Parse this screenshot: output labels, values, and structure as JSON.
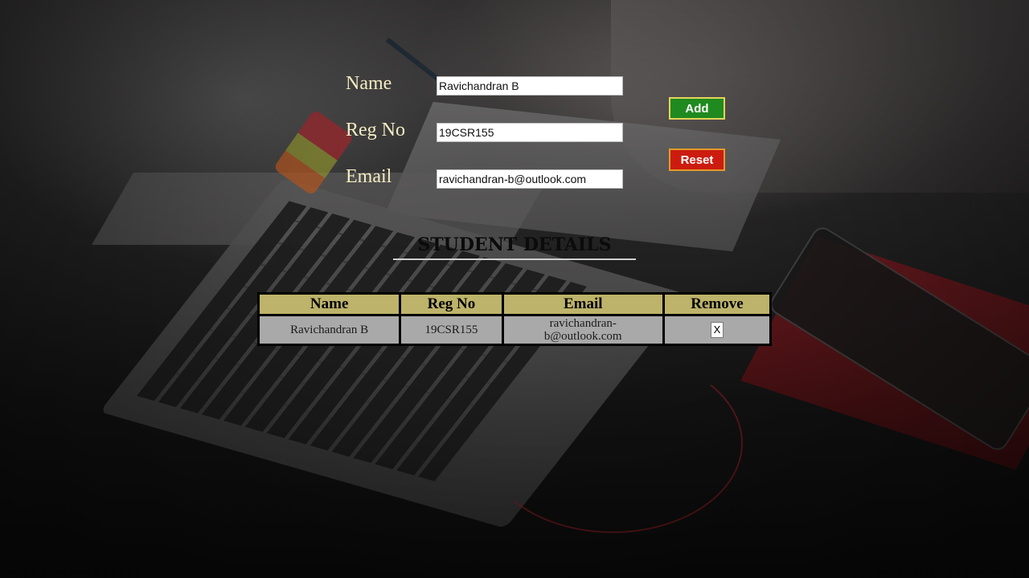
{
  "form": {
    "name_label": "Name",
    "reg_label": "Reg No",
    "email_label": "Email",
    "name_value": "Ravichandran B",
    "reg_value": "19CSR155",
    "email_value": "ravichandran-b@outlook.com",
    "add_label": "Add",
    "reset_label": "Reset",
    "add_color": "#1f8a1f",
    "reset_color": "#cc1c10"
  },
  "section": {
    "title": "STUDENT DETAILS"
  },
  "table": {
    "headers": [
      "Name",
      "Reg No",
      "Email",
      "Remove"
    ],
    "header_color": "#bdb36a",
    "row_color": "#a9a9a9",
    "rows": [
      {
        "name": "Ravichandran B",
        "reg": "19CSR155",
        "email": "ravichandran-b@outlook.com",
        "remove_label": "X"
      }
    ]
  }
}
